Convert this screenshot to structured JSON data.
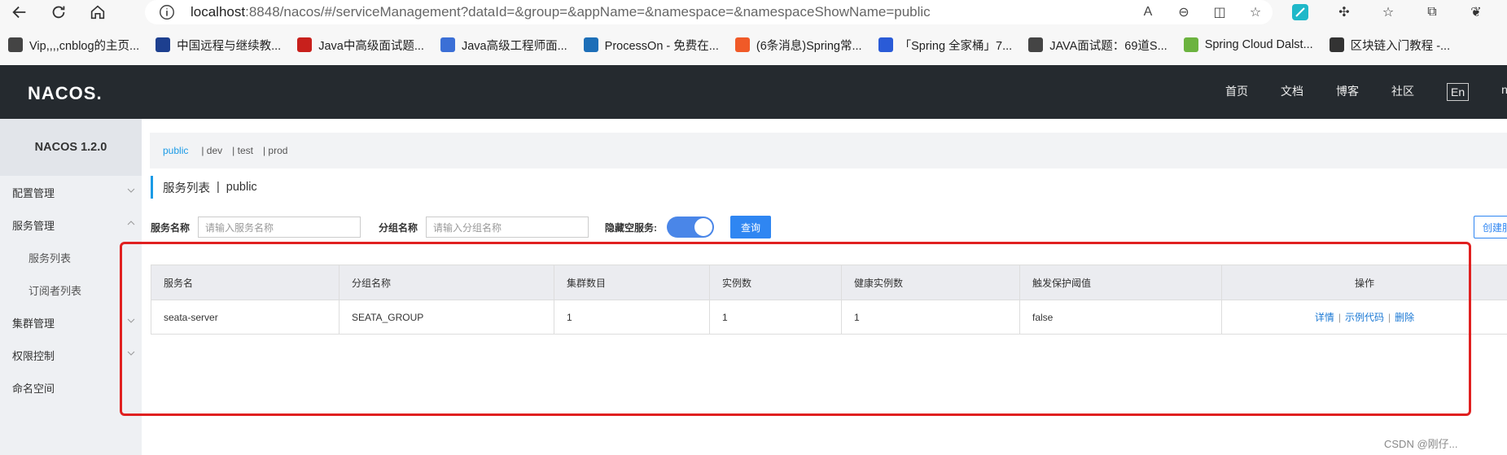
{
  "browser": {
    "url_main": "localhost",
    "url_rest": ":8848/nacos/#/serviceManagement?dataId=&group=&appName=&namespace=&namespaceShowName=public"
  },
  "bookmarks": [
    {
      "label": "Vip,,,,cnblog的主页...",
      "icon": "cnblog-icon",
      "color": "#444"
    },
    {
      "label": "中国远程与继续教...",
      "icon": "diamond-icon",
      "color": "#1d3f8f"
    },
    {
      "label": "Java中高级面试题...",
      "icon": "csdn-icon",
      "color": "#c8201c"
    },
    {
      "label": "Java高级工程师面...",
      "icon": "globe-icon",
      "color": "#3b6fd6"
    },
    {
      "label": "ProcessOn - 免费在...",
      "icon": "processon-icon",
      "color": "#1d6fb8"
    },
    {
      "label": "(6条消息)Spring常...",
      "icon": "csdn-icon",
      "color": "#f05a28"
    },
    {
      "label": "「Spring 全家桶」7...",
      "icon": "paw-icon",
      "color": "#2a5bd7"
    },
    {
      "label": "JAVA面试题：69道S...",
      "icon": "cnblog-icon",
      "color": "#444"
    },
    {
      "label": "Spring Cloud Dalst...",
      "icon": "leaf-icon",
      "color": "#6cb33f"
    },
    {
      "label": "区块链入门教程 -...",
      "icon": "runner-icon",
      "color": "#333"
    }
  ],
  "header": {
    "logo": "NACOS.",
    "nav": [
      "首页",
      "文档",
      "博客",
      "社区"
    ],
    "lang": "En",
    "user": "na"
  },
  "sidebar": {
    "title": "NACOS 1.2.0",
    "items": [
      {
        "label": "配置管理",
        "expand": "chevron-down"
      },
      {
        "label": "服务管理",
        "expand": "chevron-up"
      },
      {
        "label": "服务列表",
        "sub": true
      },
      {
        "label": "订阅者列表",
        "sub": true
      },
      {
        "label": "集群管理",
        "expand": "chevron-down"
      },
      {
        "label": "权限控制",
        "expand": "chevron-down"
      },
      {
        "label": "命名空间"
      }
    ]
  },
  "namespaces": [
    "public",
    "| dev",
    "| test",
    "| prod"
  ],
  "page": {
    "title": "服务列表",
    "divider": "|",
    "namespace": "public"
  },
  "filters": {
    "service_label": "服务名称",
    "service_placeholder": "请输入服务名称",
    "group_label": "分组名称",
    "group_placeholder": "请输入分组名称",
    "hide_empty_label": "隐藏空服务:",
    "query_button": "查询",
    "create_button": "创建服"
  },
  "table": {
    "headers": [
      "服务名",
      "分组名称",
      "集群数目",
      "实例数",
      "健康实例数",
      "触发保护阈值",
      "操作"
    ],
    "rows": [
      {
        "service": "seata-server",
        "group": "SEATA_GROUP",
        "clusters": "1",
        "instances": "1",
        "healthy": "1",
        "protect": "false",
        "ops": [
          "详情",
          "示例代码",
          "删除"
        ]
      }
    ]
  },
  "watermark": "CSDN @刚仔..."
}
